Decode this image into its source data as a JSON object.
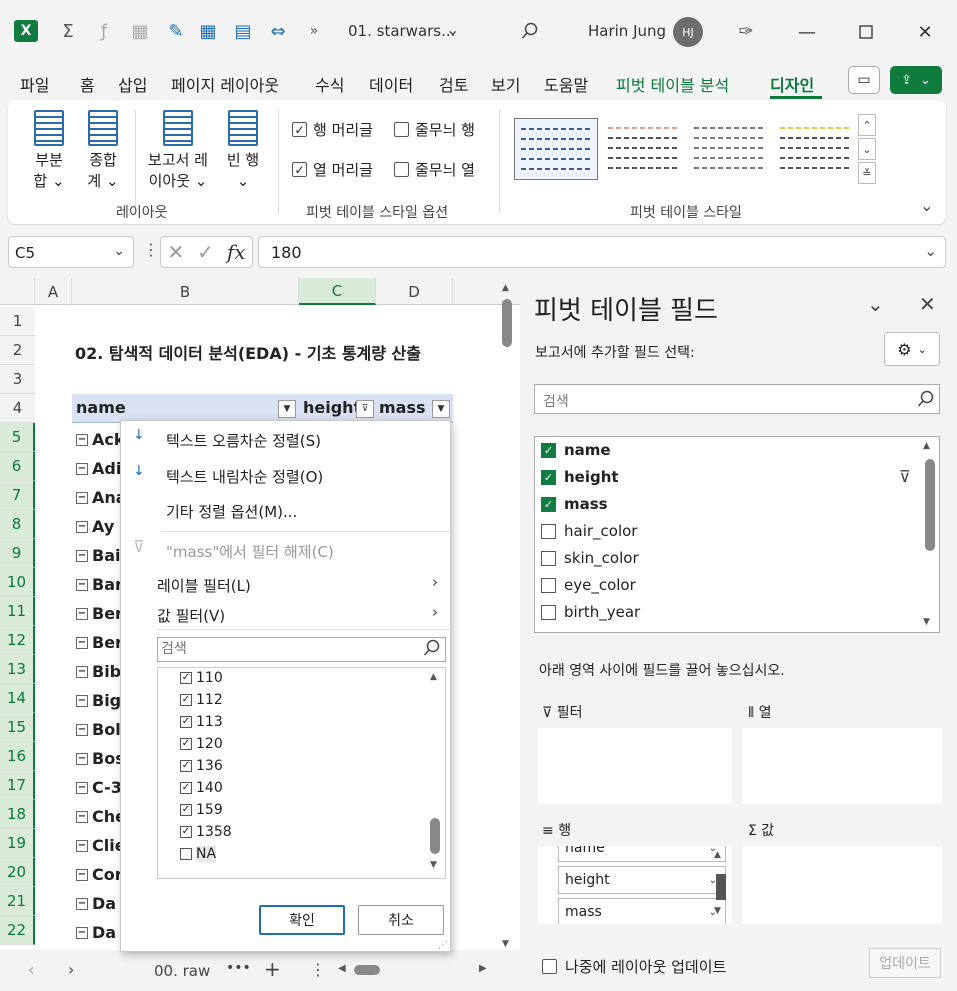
{
  "app": {
    "logo_letter": "X",
    "doc_title": "01. starwars...",
    "user_name": "Harin Jung",
    "user_initials": "HJ",
    "accent": "#107c41"
  },
  "menu": {
    "tabs": [
      "파일",
      "홈",
      "삽입",
      "페이지 레이아웃",
      "수식",
      "데이터",
      "검토",
      "보기",
      "도움말",
      "피벗 테이블 분석",
      "디자인"
    ]
  },
  "ribbon": {
    "layout_buttons": [
      {
        "line1": "부분",
        "line2": "합 ⌄"
      },
      {
        "line1": "종합",
        "line2": "계 ⌄"
      },
      {
        "line1": "보고서 레",
        "line2": "이아웃 ⌄"
      },
      {
        "line1": "빈 행",
        "line2": "⌄"
      }
    ],
    "group_layout": "레이아웃",
    "options": {
      "row_headers": "행 머리글",
      "col_headers": "열 머리글",
      "banded_rows": "줄무늬 행",
      "banded_cols": "줄무늬 열"
    },
    "group_style_options": "피벗 테이블 스타일 옵션",
    "group_styles": "피벗 테이블 스타일"
  },
  "formula_bar": {
    "name_box": "C5",
    "fx": "fx",
    "value": "180"
  },
  "grid": {
    "columns": [
      "A",
      "B",
      "C",
      "D"
    ],
    "rows": [
      "1",
      "2",
      "3",
      "4",
      "5",
      "6",
      "7",
      "8",
      "9",
      "10",
      "11",
      "12",
      "13",
      "14",
      "15",
      "16",
      "17",
      "18",
      "19",
      "20",
      "21",
      "22"
    ],
    "sheet_title": "02. 탐색적 데이터 분석(EDA) - 기초 통계량 산출",
    "header_name": "name",
    "header_height": "height",
    "header_mass": "mass",
    "row_items": [
      "Ack",
      "Adi",
      "Ana",
      "Ay",
      "Bai",
      "Bar",
      "Ber",
      "Ber",
      "Bib",
      "Big",
      "Bol",
      "Bos",
      "C-3",
      "Che",
      "Clie",
      "Cor",
      "Da",
      "Da"
    ]
  },
  "sheet_tabs": {
    "tab_name": "00. raw"
  },
  "filter_menu": {
    "sort_asc": "텍스트 오름차순 정렬(S)",
    "sort_desc": "텍스트 내림차순 정렬(O)",
    "more_sort": "기타 정렬 옵션(M)...",
    "clear_filter": "\"mass\"에서 필터 해제(C)",
    "label_filter": "레이블 필터(L)",
    "value_filter": "값 필터(V)",
    "search_placeholder": "검색",
    "values": [
      {
        "label": "110",
        "checked": true
      },
      {
        "label": "112",
        "checked": true
      },
      {
        "label": "113",
        "checked": true
      },
      {
        "label": "120",
        "checked": true
      },
      {
        "label": "136",
        "checked": true
      },
      {
        "label": "140",
        "checked": true
      },
      {
        "label": "159",
        "checked": true
      },
      {
        "label": "1358",
        "checked": true
      },
      {
        "label": "NA",
        "checked": false
      }
    ],
    "ok": "확인",
    "cancel": "취소"
  },
  "pane": {
    "title": "피벗 테이블 필드",
    "subtitle": "보고서에 추가할 필드 선택:",
    "search_placeholder": "검색",
    "fields": [
      {
        "label": "name",
        "checked": true
      },
      {
        "label": "height",
        "checked": true
      },
      {
        "label": "mass",
        "checked": true
      },
      {
        "label": "hair_color",
        "checked": false
      },
      {
        "label": "skin_color",
        "checked": false
      },
      {
        "label": "eye_color",
        "checked": false
      },
      {
        "label": "birth_year",
        "checked": false
      }
    ],
    "area_hint": "아래 영역 사이에 필드를 끌어 놓으십시오.",
    "filter_label": "필터",
    "columns_label": "열",
    "rows_label": "행",
    "values_label": "값",
    "row_fields": [
      "name",
      "height",
      "mass"
    ],
    "defer_label": "나중에 레이아웃 업데이트",
    "update_btn": "업데이트"
  }
}
